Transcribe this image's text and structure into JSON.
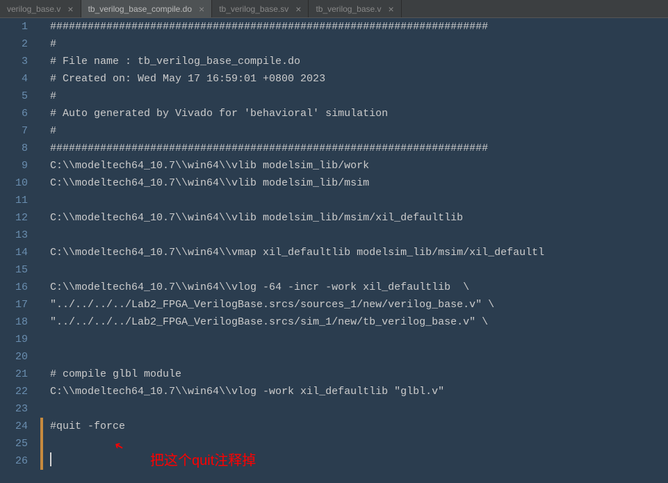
{
  "tabs": [
    {
      "label": "verilog_base.v",
      "active": false
    },
    {
      "label": "tb_verilog_base_compile.do",
      "active": true
    },
    {
      "label": "tb_verilog_base.sv",
      "active": false
    },
    {
      "label": "tb_verilog_base.v",
      "active": false
    }
  ],
  "lines": {
    "1": "######################################################################",
    "2": "#",
    "3": "# File name : tb_verilog_base_compile.do",
    "4": "# Created on: Wed May 17 16:59:01 +0800 2023",
    "5": "#",
    "6": "# Auto generated by Vivado for 'behavioral' simulation",
    "7": "#",
    "8": "######################################################################",
    "9": "C:\\\\modeltech64_10.7\\\\win64\\\\vlib modelsim_lib/work",
    "10": "C:\\\\modeltech64_10.7\\\\win64\\\\vlib modelsim_lib/msim",
    "11": "",
    "12": "C:\\\\modeltech64_10.7\\\\win64\\\\vlib modelsim_lib/msim/xil_defaultlib",
    "13": "",
    "14": "C:\\\\modeltech64_10.7\\\\win64\\\\vmap xil_defaultlib modelsim_lib/msim/xil_defaultl",
    "15": "",
    "16": "C:\\\\modeltech64_10.7\\\\win64\\\\vlog -64 -incr -work xil_defaultlib  \\",
    "17": "\"../../../../Lab2_FPGA_VerilogBase.srcs/sources_1/new/verilog_base.v\" \\",
    "18": "\"../../../../Lab2_FPGA_VerilogBase.srcs/sim_1/new/tb_verilog_base.v\" \\",
    "19": "",
    "20": "",
    "21": "# compile glbl module",
    "22": "C:\\\\modeltech64_10.7\\\\win64\\\\vlog -work xil_defaultlib \"glbl.v\"",
    "23": "",
    "24": "#quit -force",
    "25": "",
    "26": ""
  },
  "line_numbers": [
    "1",
    "2",
    "3",
    "4",
    "5",
    "6",
    "7",
    "8",
    "9",
    "10",
    "11",
    "12",
    "13",
    "14",
    "15",
    "16",
    "17",
    "18",
    "19",
    "20",
    "21",
    "22",
    "23",
    "24",
    "25",
    "26"
  ],
  "annotation": {
    "text": "把这个quit注释掉"
  }
}
